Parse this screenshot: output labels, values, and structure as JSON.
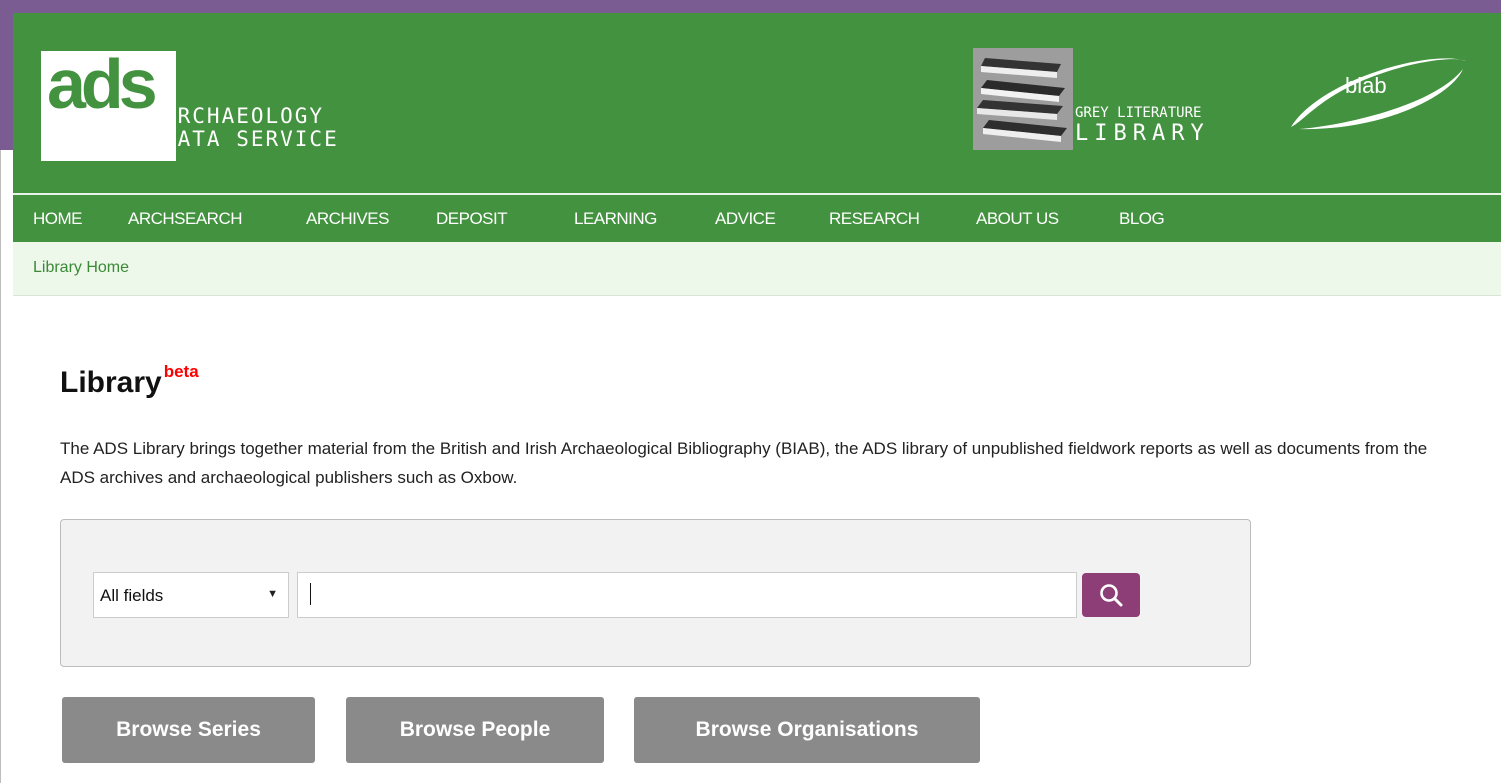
{
  "header": {
    "ads_logo_letters": "ads",
    "ads_name_line1": "ARCHAEOLOGY",
    "ads_name_line2": "DATA SERVICE",
    "grey_lit_line1": "GREY LITERATURE",
    "grey_lit_line2": "LIBRARY",
    "biab_logo_text": "biab"
  },
  "nav": {
    "items": [
      {
        "label": "HOME"
      },
      {
        "label": "ARCHSEARCH"
      },
      {
        "label": "ARCHIVES"
      },
      {
        "label": "DEPOSIT"
      },
      {
        "label": "LEARNING"
      },
      {
        "label": "ADVICE"
      },
      {
        "label": "RESEARCH"
      },
      {
        "label": "ABOUT US"
      },
      {
        "label": "BLOG"
      }
    ]
  },
  "breadcrumb": {
    "label": "Library Home"
  },
  "main": {
    "title": "Library",
    "title_badge": "beta",
    "intro": "The ADS Library brings together material from the British and Irish Archaeological Bibliography (BIAB), the ADS library of unpublished fieldwork reports as well as documents from the ADS archives and archaeological publishers such as Oxbow."
  },
  "search": {
    "field_selected": "All fields",
    "query_value": "",
    "button_icon": "search-icon"
  },
  "browse": {
    "series_label": "Browse Series",
    "people_label": "Browse People",
    "organisations_label": "Browse Organisations"
  },
  "colors": {
    "header_green": "#43923f",
    "breadcrumb_bg": "#edf8ea",
    "search_button": "#8e3e77",
    "browse_button": "#8a8a8a",
    "beta_red": "#ff0000",
    "frame_purple": "#7a5c93"
  }
}
